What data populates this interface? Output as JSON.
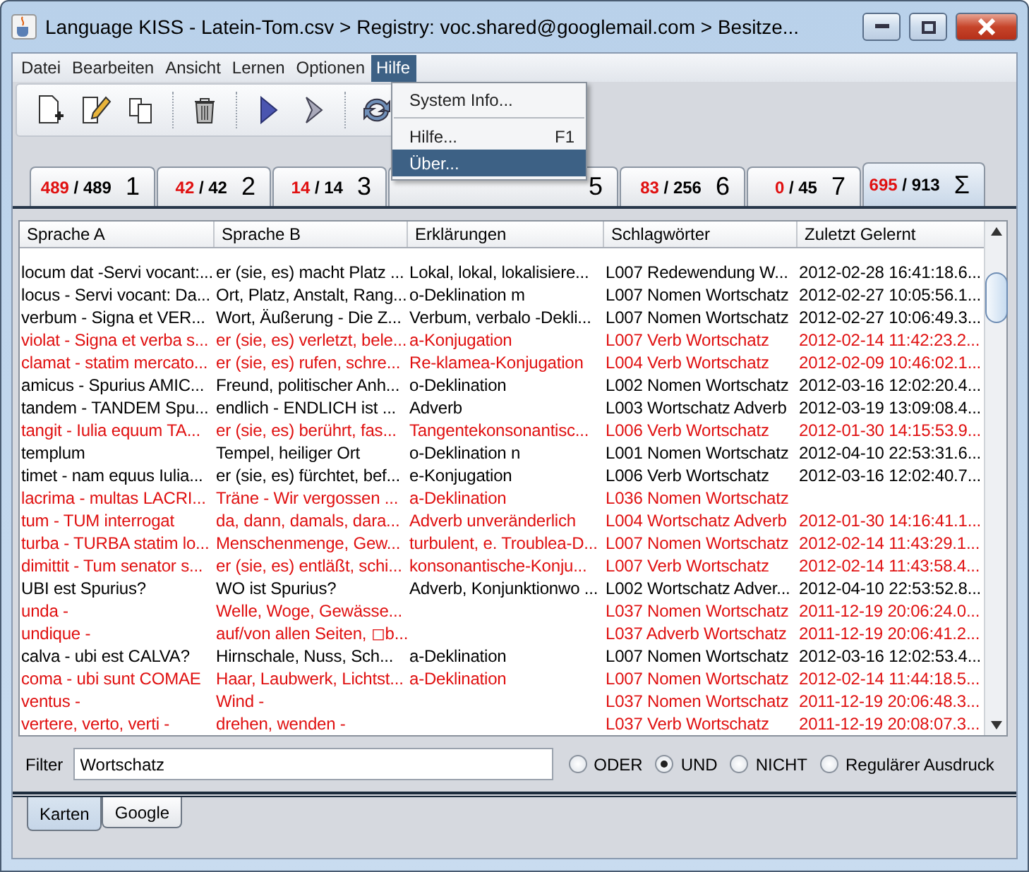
{
  "window": {
    "title": "Language KISS - Latein-Tom.csv > Registry: voc.shared@googlemail.com > Besitze..."
  },
  "menu": [
    {
      "label": "Datei",
      "selected": false
    },
    {
      "label": "Bearbeiten",
      "selected": false
    },
    {
      "label": "Ansicht",
      "selected": false
    },
    {
      "label": "Lernen",
      "selected": false
    },
    {
      "label": "Optionen",
      "selected": false
    },
    {
      "label": "Hilfe",
      "selected": true
    }
  ],
  "open_menu": {
    "items": [
      {
        "label": "System Info...",
        "selected": false,
        "separator_after": true
      },
      {
        "label": "Hilfe...",
        "shortcut": "F1",
        "selected": false,
        "separator_after": false
      },
      {
        "label": "Über...",
        "selected": true,
        "separator_after": false
      }
    ]
  },
  "toolbar": [
    {
      "kind": "new-document"
    },
    {
      "kind": "edit"
    },
    {
      "kind": "copy"
    },
    {
      "kind": "delete"
    },
    {
      "kind": "play"
    },
    {
      "kind": "next"
    },
    {
      "kind": "refresh"
    }
  ],
  "box_tabs": [
    {
      "due": "489",
      "total": "/ 489",
      "label": "1",
      "selected": false
    },
    {
      "due": "42",
      "total": "/ 42",
      "label": "2",
      "selected": false
    },
    {
      "due": "14",
      "total": "/ 14",
      "label": "3",
      "selected": false
    },
    {
      "label": "5",
      "selected": false
    },
    {
      "due": "83",
      "total": "/ 256",
      "label": "6",
      "selected": false
    },
    {
      "due": "0",
      "total": "/ 45",
      "label": "7",
      "selected": false
    },
    {
      "due": "695",
      "total": "/ 913",
      "label": "Σ",
      "selected": true
    }
  ],
  "table": {
    "columns": [
      "Sprache A",
      "Sprache B",
      "Erklärungen",
      "Schlagwörter",
      "Zuletzt Gelernt"
    ],
    "rows": [
      {
        "color": "#000000",
        "cells": [
          "locum dat -Servi vocant:...",
          "er (sie, es) macht Platz ...",
          "Lokal, lokal, lokalisiere...",
          "L007 Redewendung W...",
          "2012-02-28 16:41:18.6..."
        ]
      },
      {
        "color": "#000000",
        "cells": [
          "locus - Servi vocant: Da...",
          "Ort, Platz, Anstalt, Rang...",
          "o-Deklination m",
          "L007 Nomen Wortschatz",
          "2012-02-27 10:05:56.1..."
        ]
      },
      {
        "color": "#000000",
        "cells": [
          "verbum - Signa et VER...",
          "Wort, Äußerung - Die Z...",
          "Verbum, verbalo -Dekli...",
          "L007 Nomen Wortschatz",
          "2012-02-27 10:06:49.3..."
        ]
      },
      {
        "color": "#e01010",
        "cells": [
          "violat - Signa et verba s...",
          "er (sie, es) verletzt, bele...",
          "a-Konjugation",
          "L007 Verb Wortschatz",
          "2012-02-14 11:42:23.2..."
        ]
      },
      {
        "color": "#e01010",
        "cells": [
          "clamat - statim mercato...",
          "er (sie, es) rufen, schre...",
          "Re-klamea-Konjugation",
          "L004 Verb Wortschatz",
          "2012-02-09 10:46:02.1..."
        ]
      },
      {
        "color": "#000000",
        "cells": [
          "amicus - Spurius AMIC...",
          "Freund, politischer Anh...",
          "o-Deklination",
          "L002 Nomen Wortschatz",
          "2012-03-16 12:02:20.4..."
        ]
      },
      {
        "color": "#000000",
        "cells": [
          "tandem - TANDEM Spu...",
          "endlich - ENDLICH ist ...",
          "Adverb",
          "L003 Wortschatz Adverb",
          "2012-03-19 13:09:08.4..."
        ]
      },
      {
        "color": "#e01010",
        "cells": [
          "tangit - Iulia equum TA...",
          "er (sie, es) berührt, fas...",
          "Tangentekonsonantisc...",
          "L006 Verb Wortschatz",
          "2012-01-30 14:15:53.9..."
        ]
      },
      {
        "color": "#000000",
        "cells": [
          "templum",
          "Tempel, heiliger Ort",
          "o-Deklination n",
          "L001 Nomen Wortschatz",
          "2012-04-10 22:53:31.6..."
        ]
      },
      {
        "color": "#000000",
        "cells": [
          "timet - nam equus Iulia...",
          "er (sie, es) fürchtet, bef...",
          "e-Konjugation",
          "L006 Verb Wortschatz",
          "2012-03-16 12:02:40.7..."
        ]
      },
      {
        "color": "#e01010",
        "cells": [
          "lacrima - multas LACRI...",
          "Träne - Wir vergossen ...",
          "a-Deklination",
          "L036 Nomen Wortschatz"
        ]
      },
      {
        "color": "#e01010",
        "cells": [
          "tum - TUM interrogat",
          "da, dann, damals, dara...",
          "Adverb unveränderlich",
          "L004 Wortschatz Adverb",
          "2012-01-30 14:16:41.1..."
        ]
      },
      {
        "color": "#e01010",
        "cells": [
          "turba - TURBA statim lo...",
          "Menschenmenge, Gew...",
          "turbulent, e. Troublea-D...",
          "L007 Nomen Wortschatz",
          "2012-02-14 11:43:29.1..."
        ]
      },
      {
        "color": "#e01010",
        "cells": [
          "dimittit - Tum senator s...",
          "er (sie, es) entläßt, schi...",
          "konsonantische-Konju...",
          "L007 Verb Wortschatz",
          "2012-02-14 11:43:58.4..."
        ]
      },
      {
        "color": "#000000",
        "cells": [
          "UBI est Spurius?",
          "WO ist Spurius?",
          "Adverb, Konjunktionwo ...",
          "L002 Wortschatz Adver...",
          "2012-04-10 22:53:52.8..."
        ]
      },
      {
        "color": "#e01010",
        "cells": [
          "unda -",
          "Welle, Woge, Gewässe...",
          "",
          "L037 Nomen Wortschatz",
          "2011-12-19 20:06:24.0..."
        ]
      },
      {
        "color": "#e01010",
        "cells": [
          "undique -",
          "auf/von allen Seiten, ◻b...",
          "",
          "L037 Adverb Wortschatz",
          "2011-12-19 20:06:41.2..."
        ]
      },
      {
        "color": "#000000",
        "cells": [
          "calva - ubi est CALVA?",
          "Hirnschale, Nuss, Sch...",
          "a-Deklination",
          "L007 Nomen Wortschatz",
          "2012-03-16 12:02:53.4..."
        ]
      },
      {
        "color": "#e01010",
        "cells": [
          "coma - ubi sunt COMAE",
          "Haar, Laubwerk, Lichtst...",
          "a-Deklination",
          "L007 Nomen Wortschatz",
          "2012-02-14 11:44:18.5..."
        ]
      },
      {
        "color": "#e01010",
        "cells": [
          "ventus -",
          "Wind -",
          "",
          "L037 Nomen Wortschatz",
          "2011-12-19 20:06:48.3..."
        ]
      },
      {
        "color": "#e01010",
        "cells": [
          "vertere, verto, verti -",
          "drehen, wenden -",
          "",
          "L037 Verb Wortschatz",
          "2011-12-19 20:08:07.3..."
        ]
      }
    ]
  },
  "filter": {
    "label": "Filter",
    "value": "Wortschatz",
    "options": [
      {
        "label": "ODER",
        "selected": false
      },
      {
        "label": "UND",
        "selected": true
      },
      {
        "label": "NICHT",
        "selected": false
      },
      {
        "label": "Regulärer Ausdruck",
        "selected": false
      }
    ]
  },
  "bottom_tabs": [
    {
      "label": "Karten",
      "selected": true
    },
    {
      "label": "Google",
      "selected": false
    }
  ]
}
